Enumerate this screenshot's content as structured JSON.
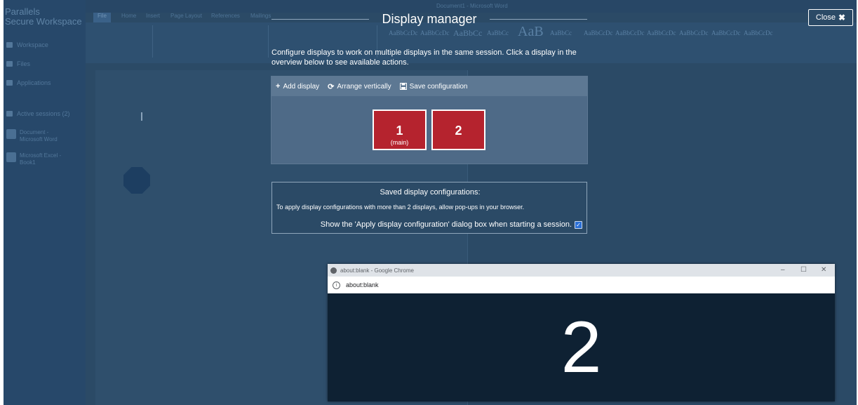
{
  "background_app": {
    "brand": [
      "Parallels",
      "Secure Workspace"
    ],
    "sidebar": {
      "workspace": "Workspace",
      "files": "Files",
      "applications": "Applications",
      "active_sessions": "Active sessions (2)",
      "session_word": [
        "Document -",
        "Microsoft Word"
      ],
      "session_excel": [
        "Microsoft Excel -",
        "Book1"
      ]
    },
    "ribbon_tabs": [
      "File",
      "Home",
      "Insert",
      "Page Layout",
      "References",
      "Mailings"
    ],
    "window_title": "Document1 - Microsoft Word",
    "styles": [
      "AaBbCcDc",
      "AaBbCcDc",
      "AaBbCc",
      "AaBbCc",
      "AaB",
      "AaBbCc",
      "AaBbCcDc",
      "AaBbCcDc",
      "AaBbCcDc",
      "AaBbCcDc",
      "AaBbCcDc",
      "AaBbCcDc"
    ]
  },
  "dialog": {
    "title": "Display manager",
    "close_label": "Close",
    "intro": "Configure displays to work on multiple displays in the same session. Click a display in the overview below to see available actions.",
    "toolbar": {
      "add_display": "Add display",
      "arrange_vertically": "Arrange vertically",
      "save_configuration": "Save configuration"
    },
    "displays": [
      {
        "number": "1",
        "sub": "(main)"
      },
      {
        "number": "2",
        "sub": ""
      }
    ],
    "saved": {
      "title": "Saved display configurations:",
      "note": "To apply display configurations with more than 2 displays, allow pop-ups in your browser.",
      "checkbox_label": "Show the 'Apply display configuration' dialog box when starting a session.",
      "checked": true
    }
  },
  "popup": {
    "title": "about:blank - Google Chrome",
    "address": "about:blank",
    "display_number": "2",
    "controls": [
      "–",
      "☐",
      "✕"
    ]
  },
  "colors": {
    "accent_display": "#b5232e",
    "overlay_bg": "#2b4a66",
    "checkbox": "#2a6fd6"
  }
}
